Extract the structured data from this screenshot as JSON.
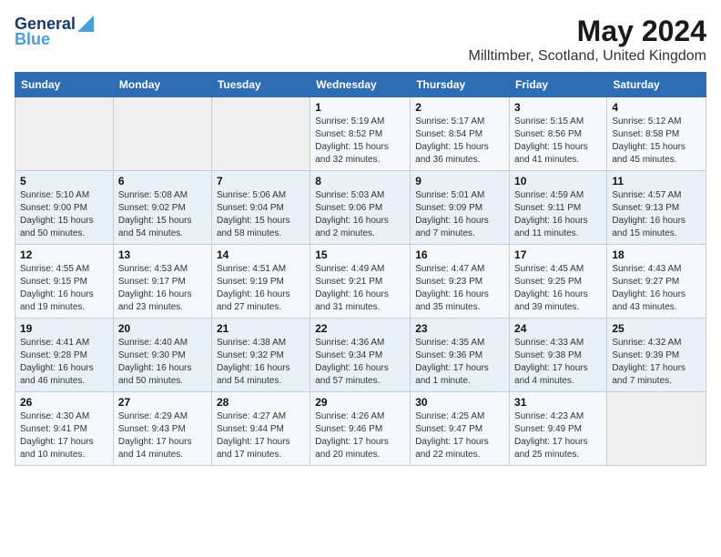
{
  "header": {
    "logo_general": "General",
    "logo_blue": "Blue",
    "month": "May 2024",
    "location": "Milltimber, Scotland, United Kingdom"
  },
  "days_of_week": [
    "Sunday",
    "Monday",
    "Tuesday",
    "Wednesday",
    "Thursday",
    "Friday",
    "Saturday"
  ],
  "weeks": [
    [
      {
        "day": "",
        "info": ""
      },
      {
        "day": "",
        "info": ""
      },
      {
        "day": "",
        "info": ""
      },
      {
        "day": "1",
        "info": "Sunrise: 5:19 AM\nSunset: 8:52 PM\nDaylight: 15 hours\nand 32 minutes."
      },
      {
        "day": "2",
        "info": "Sunrise: 5:17 AM\nSunset: 8:54 PM\nDaylight: 15 hours\nand 36 minutes."
      },
      {
        "day": "3",
        "info": "Sunrise: 5:15 AM\nSunset: 8:56 PM\nDaylight: 15 hours\nand 41 minutes."
      },
      {
        "day": "4",
        "info": "Sunrise: 5:12 AM\nSunset: 8:58 PM\nDaylight: 15 hours\nand 45 minutes."
      }
    ],
    [
      {
        "day": "5",
        "info": "Sunrise: 5:10 AM\nSunset: 9:00 PM\nDaylight: 15 hours\nand 50 minutes."
      },
      {
        "day": "6",
        "info": "Sunrise: 5:08 AM\nSunset: 9:02 PM\nDaylight: 15 hours\nand 54 minutes."
      },
      {
        "day": "7",
        "info": "Sunrise: 5:06 AM\nSunset: 9:04 PM\nDaylight: 15 hours\nand 58 minutes."
      },
      {
        "day": "8",
        "info": "Sunrise: 5:03 AM\nSunset: 9:06 PM\nDaylight: 16 hours\nand 2 minutes."
      },
      {
        "day": "9",
        "info": "Sunrise: 5:01 AM\nSunset: 9:09 PM\nDaylight: 16 hours\nand 7 minutes."
      },
      {
        "day": "10",
        "info": "Sunrise: 4:59 AM\nSunset: 9:11 PM\nDaylight: 16 hours\nand 11 minutes."
      },
      {
        "day": "11",
        "info": "Sunrise: 4:57 AM\nSunset: 9:13 PM\nDaylight: 16 hours\nand 15 minutes."
      }
    ],
    [
      {
        "day": "12",
        "info": "Sunrise: 4:55 AM\nSunset: 9:15 PM\nDaylight: 16 hours\nand 19 minutes."
      },
      {
        "day": "13",
        "info": "Sunrise: 4:53 AM\nSunset: 9:17 PM\nDaylight: 16 hours\nand 23 minutes."
      },
      {
        "day": "14",
        "info": "Sunrise: 4:51 AM\nSunset: 9:19 PM\nDaylight: 16 hours\nand 27 minutes."
      },
      {
        "day": "15",
        "info": "Sunrise: 4:49 AM\nSunset: 9:21 PM\nDaylight: 16 hours\nand 31 minutes."
      },
      {
        "day": "16",
        "info": "Sunrise: 4:47 AM\nSunset: 9:23 PM\nDaylight: 16 hours\nand 35 minutes."
      },
      {
        "day": "17",
        "info": "Sunrise: 4:45 AM\nSunset: 9:25 PM\nDaylight: 16 hours\nand 39 minutes."
      },
      {
        "day": "18",
        "info": "Sunrise: 4:43 AM\nSunset: 9:27 PM\nDaylight: 16 hours\nand 43 minutes."
      }
    ],
    [
      {
        "day": "19",
        "info": "Sunrise: 4:41 AM\nSunset: 9:28 PM\nDaylight: 16 hours\nand 46 minutes."
      },
      {
        "day": "20",
        "info": "Sunrise: 4:40 AM\nSunset: 9:30 PM\nDaylight: 16 hours\nand 50 minutes."
      },
      {
        "day": "21",
        "info": "Sunrise: 4:38 AM\nSunset: 9:32 PM\nDaylight: 16 hours\nand 54 minutes."
      },
      {
        "day": "22",
        "info": "Sunrise: 4:36 AM\nSunset: 9:34 PM\nDaylight: 16 hours\nand 57 minutes."
      },
      {
        "day": "23",
        "info": "Sunrise: 4:35 AM\nSunset: 9:36 PM\nDaylight: 17 hours\nand 1 minute."
      },
      {
        "day": "24",
        "info": "Sunrise: 4:33 AM\nSunset: 9:38 PM\nDaylight: 17 hours\nand 4 minutes."
      },
      {
        "day": "25",
        "info": "Sunrise: 4:32 AM\nSunset: 9:39 PM\nDaylight: 17 hours\nand 7 minutes."
      }
    ],
    [
      {
        "day": "26",
        "info": "Sunrise: 4:30 AM\nSunset: 9:41 PM\nDaylight: 17 hours\nand 10 minutes."
      },
      {
        "day": "27",
        "info": "Sunrise: 4:29 AM\nSunset: 9:43 PM\nDaylight: 17 hours\nand 14 minutes."
      },
      {
        "day": "28",
        "info": "Sunrise: 4:27 AM\nSunset: 9:44 PM\nDaylight: 17 hours\nand 17 minutes."
      },
      {
        "day": "29",
        "info": "Sunrise: 4:26 AM\nSunset: 9:46 PM\nDaylight: 17 hours\nand 20 minutes."
      },
      {
        "day": "30",
        "info": "Sunrise: 4:25 AM\nSunset: 9:47 PM\nDaylight: 17 hours\nand 22 minutes."
      },
      {
        "day": "31",
        "info": "Sunrise: 4:23 AM\nSunset: 9:49 PM\nDaylight: 17 hours\nand 25 minutes."
      },
      {
        "day": "",
        "info": ""
      }
    ]
  ]
}
